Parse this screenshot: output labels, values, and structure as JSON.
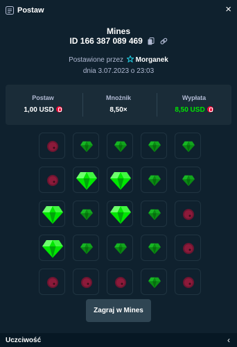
{
  "header": {
    "title": "Postaw",
    "close": "×"
  },
  "game": {
    "name": "Mines",
    "id_text": "ID 166 387 089 469"
  },
  "placed": {
    "prefix": "Postawione przez",
    "user": "Morganek"
  },
  "date_text": "dnia 3.07.2023 o 23:03",
  "stats": [
    {
      "label": "Postaw",
      "value": "1,00 USD"
    },
    {
      "label": "Mnożnik",
      "value": "8,50×"
    },
    {
      "label": "Wypłata",
      "value": "8,50 USD"
    }
  ],
  "grid": [
    [
      "mine",
      "gem",
      "gem",
      "gem",
      "gem"
    ],
    [
      "mine",
      "gem-revealed",
      "gem-revealed",
      "gem",
      "gem"
    ],
    [
      "gem-revealed",
      "gem",
      "gem-revealed",
      "gem",
      "mine"
    ],
    [
      "gem-revealed",
      "gem",
      "gem",
      "gem",
      "mine"
    ],
    [
      "mine",
      "mine",
      "mine",
      "gem",
      "mine"
    ]
  ],
  "play_button": "Zagraj w Mines",
  "footer": {
    "label": "Uczciwość",
    "chevron": "‹"
  },
  "colors": {
    "bg": "#0f212e",
    "panel": "#1a2c38",
    "green": "#00e701",
    "red": "#e9113c"
  }
}
